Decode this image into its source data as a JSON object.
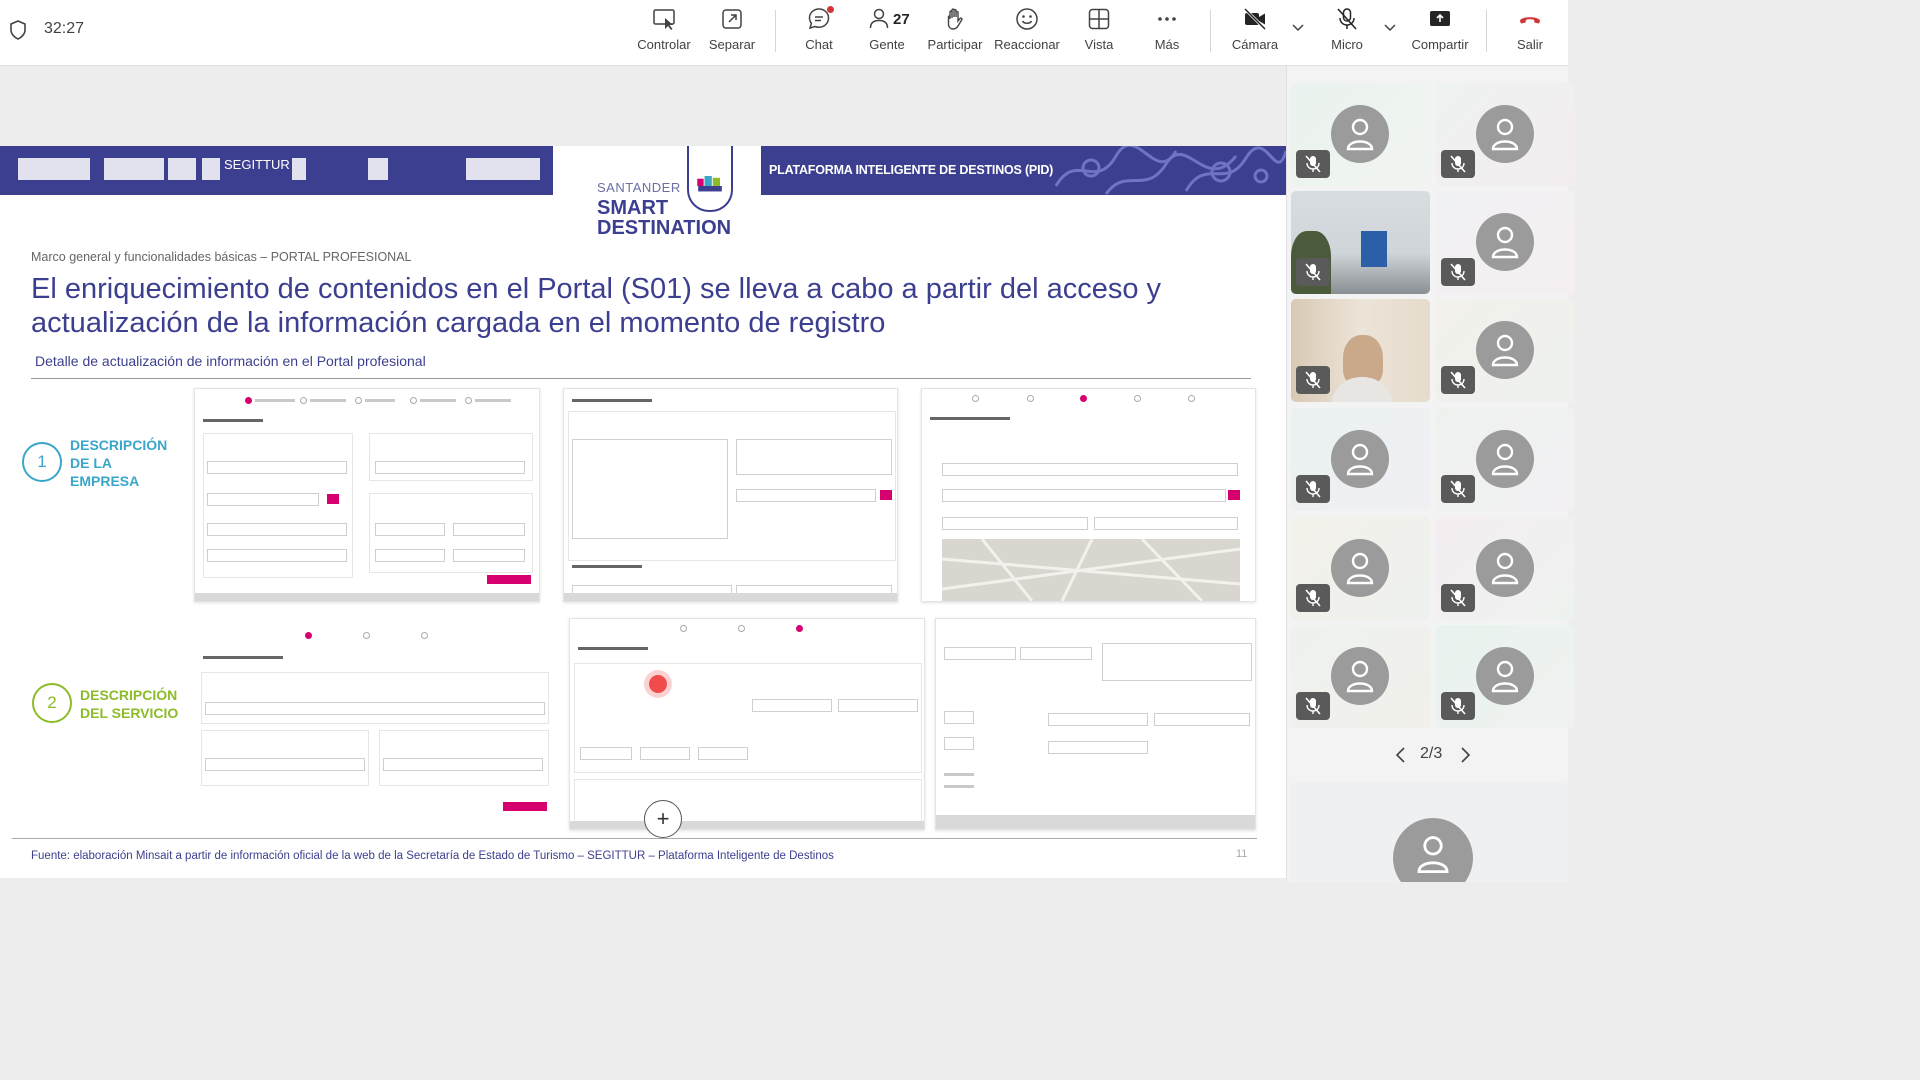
{
  "meeting": {
    "timer": "32:27"
  },
  "toolbar": {
    "items": [
      {
        "label": "Controlar",
        "icon": "share-control-icon"
      },
      {
        "label": "Separar",
        "icon": "pop-out-icon"
      },
      {
        "label": "Chat",
        "icon": "chat-icon"
      },
      {
        "label": "Gente",
        "icon": "people-icon",
        "count": "27"
      },
      {
        "label": "Participar",
        "icon": "raise-hand-icon"
      },
      {
        "label": "Reaccionar",
        "icon": "react-icon"
      },
      {
        "label": "Vista",
        "icon": "view-icon"
      },
      {
        "label": "Más",
        "icon": "more-icon"
      },
      {
        "label": "Cámara",
        "icon": "camera-off-icon"
      },
      {
        "label": "Micro",
        "icon": "mic-off-icon"
      },
      {
        "label": "Compartir",
        "icon": "share-icon"
      },
      {
        "label": "Salir",
        "icon": "leave-icon"
      }
    ],
    "leave_color": "#d13438"
  },
  "slide": {
    "logo_segittur": "SEGITTUR",
    "banner_right": "PLATAFORMA INTELIGENTE DE DESTINOS (PID)",
    "brand_line1": "SANTANDER",
    "brand_line2": "SMART",
    "brand_line3": "DESTINATION",
    "breadcrumb": "Marco general y funcionalidades básicas – PORTAL PROFESIONAL",
    "headline": "El enriquecimiento de contenidos en el Portal (S01) se lleva a cabo a partir del acceso y actualización de la información cargada en el momento de registro",
    "subtitle": "Detalle de actualización de información en el Portal profesional",
    "section1": {
      "number": "1",
      "line1": "DESCRIPCIÓN",
      "line2": "DE LA",
      "line3": "EMPRESA",
      "color": "#3aa6c9"
    },
    "section2": {
      "number": "2",
      "line1": "DESCRIPCIÓN",
      "line2": "DEL SERVICIO",
      "color": "#8dbb2a"
    },
    "footer": "Fuente: elaboración Minsait a partir de información oficial de la web de la Secretaría de Estado de Turismo – SEGITTUR – Plataforma Inteligente de Destinos",
    "page_number": "11",
    "brand_color": "#3c3f8f",
    "accent_color": "#d6006e"
  },
  "gallery": {
    "pager": "2/3",
    "prev_icon": "chevron-left-icon",
    "next_icon": "chevron-right-icon"
  }
}
